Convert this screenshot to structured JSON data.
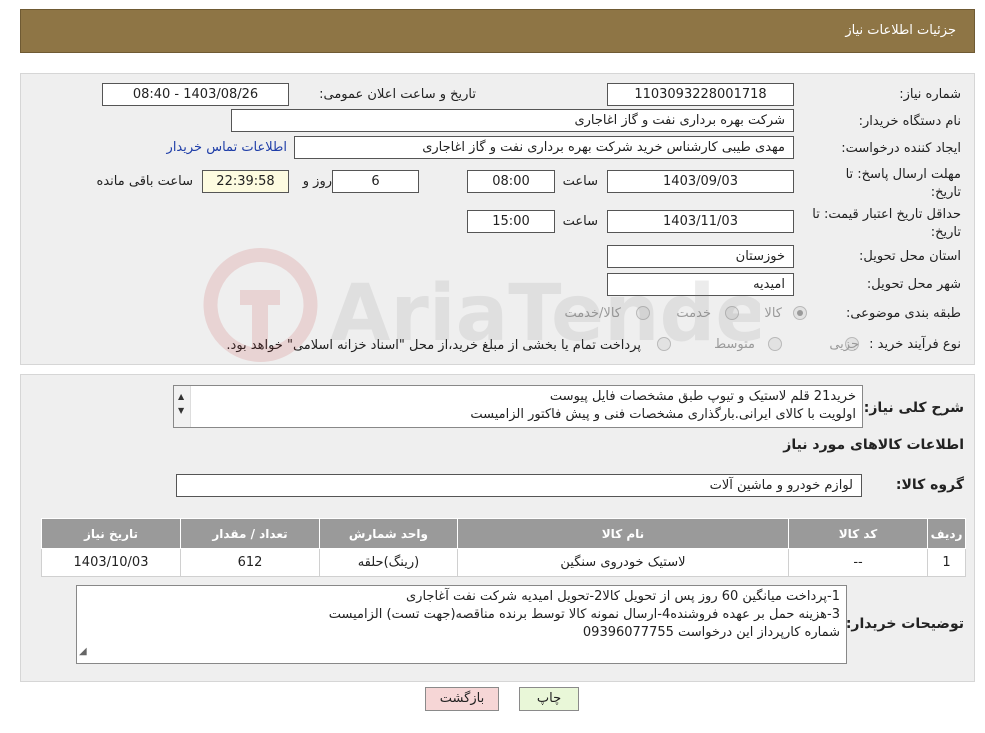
{
  "header": {
    "title": "جزئیات اطلاعات نیاز"
  },
  "form": {
    "need_number_label": "شماره نیاز:",
    "need_number": "1103093228001718",
    "announce_label": "تاریخ و ساعت اعلان عمومی:",
    "announce_value": "1403/08/26 - 08:40",
    "buyer_org_label": "نام دستگاه خریدار:",
    "buyer_org": "شرکت بهره برداری نفت و گاز اغاجاری",
    "creator_label": "ایجاد کننده درخواست:",
    "creator": "مهدی طیبی کارشناس خرید شرکت بهره برداری نفت و گاز اغاجاری",
    "contact_link": "اطلاعات تماس خریدار",
    "deadline_label_1": "مهلت ارسال پاسخ: تا",
    "deadline_label_2": "تاریخ:",
    "deadline_date": "1403/09/03",
    "time_label": "ساعت",
    "deadline_time": "08:00",
    "days_value": "6",
    "days_label": "روز و",
    "remaining_value": "22:39:58",
    "remaining_label": "ساعت باقی مانده",
    "validity_label_1": "حداقل تاریخ اعتبار قیمت: تا",
    "validity_label_2": "تاریخ:",
    "validity_date": "1403/11/03",
    "validity_time": "15:00",
    "province_label": "استان محل تحویل:",
    "province": "خوزستان",
    "city_label": "شهر محل تحویل:",
    "city": "امیدیه",
    "category_label": "طبقه بندی موضوعی:",
    "category_options": [
      "کالا",
      "خدمت",
      "کالا/خدمت"
    ],
    "process_label": "نوع فرآیند خرید :",
    "process_options": [
      "جزیی",
      "متوسط"
    ],
    "process_note": "پرداخت تمام یا بخشی از مبلغ خرید،از محل \"اسناد خزانه اسلامی\" خواهد بود."
  },
  "details": {
    "summary_label": "شرح کلی نیاز:",
    "summary_lines": [
      "خرید21 قلم لاستیک و تیوپ طبق مشخصات فایل پیوست",
      "اولویت با کالای ایرانی.بارگذاری مشخصات فنی و پیش فاکتور الزامیست"
    ],
    "items_heading": "اطلاعات کالاهای مورد نیاز",
    "group_label": "گروه کالا:",
    "group_value": "لوازم خودرو و ماشین آلات",
    "table_headers": [
      "ردیف",
      "کد کالا",
      "نام کالا",
      "واحد شمارش",
      "تعداد / مقدار",
      "تاریخ نیاز"
    ],
    "table_rows": [
      [
        "1",
        "--",
        "لاستیک خودروی سنگین",
        "(رینگ)حلقه",
        "612",
        "1403/10/03"
      ]
    ],
    "buyer_notes_label": "توضیحات خریدار:",
    "buyer_notes_lines": [
      "1-پرداخت میانگین 60 روز پس از تحویل کالا2-تحویل امیدیه شرکت نفت آغاجاری",
      "3-هزینه حمل بر عهده فروشنده4-ارسال نمونه کالا توسط برنده مناقصه(جهت تست) الزامیست",
      "شماره کارپرداز این درخواست 09396077755"
    ]
  },
  "buttons": {
    "print": "چاپ",
    "back": "بازگشت"
  },
  "watermark": "AriaTender.neT"
}
